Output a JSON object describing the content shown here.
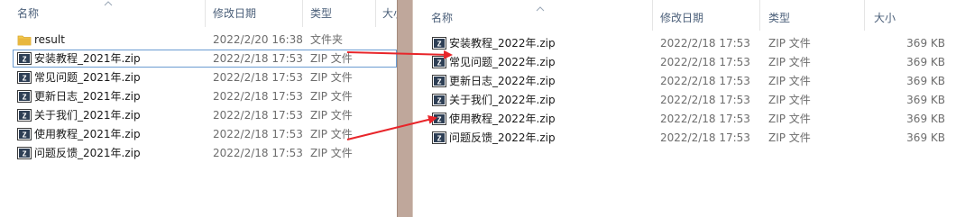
{
  "left": {
    "columns": {
      "name": "名称",
      "date": "修改日期",
      "type": "类型",
      "size": "大小"
    },
    "rows": [
      {
        "name": "result",
        "date": "2022/2/20 16:38",
        "type": "文件夹",
        "icon": "folder-icon"
      },
      {
        "name": "安装教程_2021年.zip",
        "date": "2022/2/18 17:53",
        "type": "ZIP 文件",
        "icon": "zip-archive-icon"
      },
      {
        "name": "常见问题_2021年.zip",
        "date": "2022/2/18 17:53",
        "type": "ZIP 文件",
        "icon": "zip-archive-icon"
      },
      {
        "name": "更新日志_2021年.zip",
        "date": "2022/2/18 17:53",
        "type": "ZIP 文件",
        "icon": "zip-archive-icon"
      },
      {
        "name": "关于我们_2021年.zip",
        "date": "2022/2/18 17:53",
        "type": "ZIP 文件",
        "icon": "zip-archive-icon"
      },
      {
        "name": "使用教程_2021年.zip",
        "date": "2022/2/18 17:53",
        "type": "ZIP 文件",
        "icon": "zip-archive-icon"
      },
      {
        "name": "问题反馈_2021年.zip",
        "date": "2022/2/18 17:53",
        "type": "ZIP 文件",
        "icon": "zip-archive-icon"
      }
    ]
  },
  "right": {
    "columns": {
      "name": "名称",
      "date": "修改日期",
      "type": "类型",
      "size": "大小"
    },
    "rows": [
      {
        "name": "安装教程_2022年.zip",
        "date": "2022/2/18 17:53",
        "type": "ZIP 文件",
        "size": "369 KB",
        "icon": "zip-archive-icon"
      },
      {
        "name": "常见问题_2022年.zip",
        "date": "2022/2/18 17:53",
        "type": "ZIP 文件",
        "size": "369 KB",
        "icon": "zip-archive-icon"
      },
      {
        "name": "更新日志_2022年.zip",
        "date": "2022/2/18 17:53",
        "type": "ZIP 文件",
        "size": "369 KB",
        "icon": "zip-archive-icon"
      },
      {
        "name": "关于我们_2022年.zip",
        "date": "2022/2/18 17:53",
        "type": "ZIP 文件",
        "size": "369 KB",
        "icon": "zip-archive-icon"
      },
      {
        "name": "使用教程_2022年.zip",
        "date": "2022/2/18 17:53",
        "type": "ZIP 文件",
        "size": "369 KB",
        "icon": "zip-archive-icon"
      },
      {
        "name": "问题反馈_2022年.zip",
        "date": "2022/2/18 17:53",
        "type": "ZIP 文件",
        "size": "369 KB",
        "icon": "zip-archive-icon"
      }
    ]
  },
  "colors": {
    "header_text": "#4c607a",
    "meta_text": "#6d6d6d",
    "selection_outline": "#6a9bd1",
    "folder_yellow": "#e8b73f",
    "arrow_red": "#e8252a",
    "splitter": "#bfa79b"
  }
}
